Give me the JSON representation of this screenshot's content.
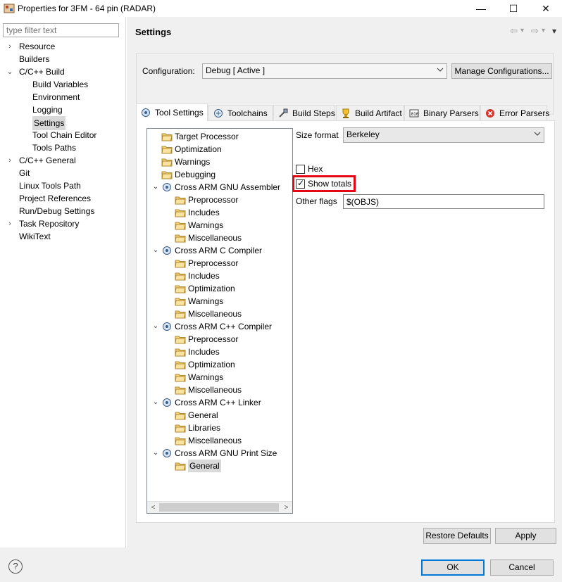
{
  "window": {
    "title": "Properties for 3FM - 64 pin (RADAR)",
    "minimize_glyph": "—",
    "maximize_glyph": "☐",
    "close_glyph": "✕"
  },
  "filter": {
    "placeholder": "type filter text"
  },
  "nav": {
    "items": [
      {
        "label": "Resource",
        "twisty": "›"
      },
      {
        "label": "Builders",
        "twisty": ""
      },
      {
        "label": "C/C++ Build",
        "twisty": "⌄"
      },
      {
        "label": "Build Variables",
        "twisty": ""
      },
      {
        "label": "Environment",
        "twisty": ""
      },
      {
        "label": "Logging",
        "twisty": ""
      },
      {
        "label": "Settings",
        "twisty": ""
      },
      {
        "label": "Tool Chain Editor",
        "twisty": ""
      },
      {
        "label": "Tools Paths",
        "twisty": ""
      },
      {
        "label": "C/C++ General",
        "twisty": "›"
      },
      {
        "label": "Git",
        "twisty": ""
      },
      {
        "label": "Linux Tools Path",
        "twisty": ""
      },
      {
        "label": "Project References",
        "twisty": ""
      },
      {
        "label": "Run/Debug Settings",
        "twisty": ""
      },
      {
        "label": "Task Repository",
        "twisty": "›"
      },
      {
        "label": "WikiText",
        "twisty": ""
      }
    ]
  },
  "header": {
    "title": "Settings",
    "back_glyph": "⇦",
    "dropdown_glyph": "▾",
    "forward_glyph": "⇨",
    "menu_glyph": "▾"
  },
  "configuration": {
    "label": "Configuration:",
    "value": "Debug  [ Active ]",
    "manage_label": "Manage Configurations..."
  },
  "tabs": [
    {
      "label": "Tool Settings",
      "icon": "tool-settings-icon"
    },
    {
      "label": "Toolchains",
      "icon": "toolchains-icon"
    },
    {
      "label": "Build Steps",
      "icon": "build-steps-icon"
    },
    {
      "label": "Build Artifact",
      "icon": "trophy-icon"
    },
    {
      "label": "Binary Parsers",
      "icon": "binary-icon"
    },
    {
      "label": "Error Parsers",
      "icon": "error-icon"
    }
  ],
  "tool_tree": [
    {
      "label": "Target Processor",
      "kind": "folder",
      "twisty": ""
    },
    {
      "label": "Optimization",
      "kind": "folder",
      "twisty": ""
    },
    {
      "label": "Warnings",
      "kind": "folder",
      "twisty": ""
    },
    {
      "label": "Debugging",
      "kind": "folder",
      "twisty": ""
    },
    {
      "label": "Cross ARM GNU Assembler",
      "kind": "tool",
      "twisty": "⌄"
    },
    {
      "label": "Preprocessor",
      "kind": "folder",
      "twisty": ""
    },
    {
      "label": "Includes",
      "kind": "folder",
      "twisty": ""
    },
    {
      "label": "Warnings",
      "kind": "folder",
      "twisty": ""
    },
    {
      "label": "Miscellaneous",
      "kind": "folder",
      "twisty": ""
    },
    {
      "label": "Cross ARM C Compiler",
      "kind": "tool",
      "twisty": "⌄"
    },
    {
      "label": "Preprocessor",
      "kind": "folder",
      "twisty": ""
    },
    {
      "label": "Includes",
      "kind": "folder",
      "twisty": ""
    },
    {
      "label": "Optimization",
      "kind": "folder",
      "twisty": ""
    },
    {
      "label": "Warnings",
      "kind": "folder",
      "twisty": ""
    },
    {
      "label": "Miscellaneous",
      "kind": "folder",
      "twisty": ""
    },
    {
      "label": "Cross ARM C++ Compiler",
      "kind": "tool",
      "twisty": "⌄"
    },
    {
      "label": "Preprocessor",
      "kind": "folder",
      "twisty": ""
    },
    {
      "label": "Includes",
      "kind": "folder",
      "twisty": ""
    },
    {
      "label": "Optimization",
      "kind": "folder",
      "twisty": ""
    },
    {
      "label": "Warnings",
      "kind": "folder",
      "twisty": ""
    },
    {
      "label": "Miscellaneous",
      "kind": "folder",
      "twisty": ""
    },
    {
      "label": "Cross ARM C++ Linker",
      "kind": "tool",
      "twisty": "⌄"
    },
    {
      "label": "General",
      "kind": "folder",
      "twisty": ""
    },
    {
      "label": "Libraries",
      "kind": "folder",
      "twisty": ""
    },
    {
      "label": "Miscellaneous",
      "kind": "folder",
      "twisty": ""
    },
    {
      "label": "Cross ARM GNU Print Size",
      "kind": "tool",
      "twisty": "⌄"
    },
    {
      "label": "General",
      "kind": "folder",
      "twisty": ""
    }
  ],
  "form": {
    "size_format_label": "Size format",
    "size_format_value": "Berkeley",
    "hex_label": "Hex",
    "hex_checked": false,
    "show_totals_label": "Show totals",
    "show_totals_checked": true,
    "check_glyph": "✓",
    "other_flags_label": "Other flags",
    "other_flags_value": "$(OBJS)"
  },
  "scroll": {
    "left_glyph": "<",
    "right_glyph": ">"
  },
  "buttons": {
    "restore_defaults": "Restore Defaults",
    "apply": "Apply",
    "ok": "OK",
    "cancel": "Cancel",
    "help": "?"
  },
  "colors": {
    "highlight_border": "#e30613",
    "ok_border": "#0078d7"
  }
}
